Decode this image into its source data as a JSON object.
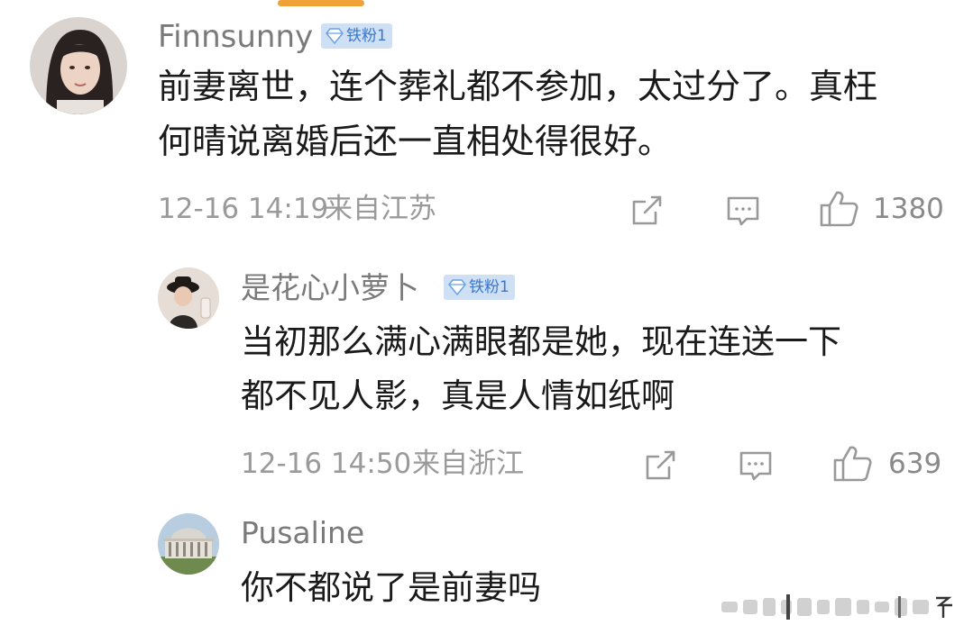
{
  "comments": [
    {
      "username": "Finnsunny",
      "badge": "铁粉1",
      "text_lines": [
        "前妻离世，连个葬礼都不参加，太过分了。真枉",
        "何晴说离婚后还一直相处得很好。"
      ],
      "time": "12-16 14:19",
      "location": "来自江苏",
      "likes": "1380"
    },
    {
      "username": "是花心小萝卜",
      "badge": "铁粉1",
      "text_lines": [
        "当初那么满心满眼都是她，现在连送一下",
        "都不见人影，真是人情如纸啊"
      ],
      "time": "12-16 14:50",
      "location": "来自浙江",
      "likes": "639"
    },
    {
      "username": "Pusaline",
      "text_lines": [
        "你不都说了是前妻吗"
      ]
    }
  ],
  "icons": {
    "share": "share-icon",
    "reply": "comment-icon",
    "like": "thumbs-up-icon",
    "badge": "diamond-icon"
  },
  "colors": {
    "username": "#7a7a7a",
    "body_text": "#1a1a1a",
    "meta": "#9a9a9a",
    "badge_bg": "#cfe0f5",
    "badge_text": "#3b77c9",
    "accent": "#f0a238"
  }
}
